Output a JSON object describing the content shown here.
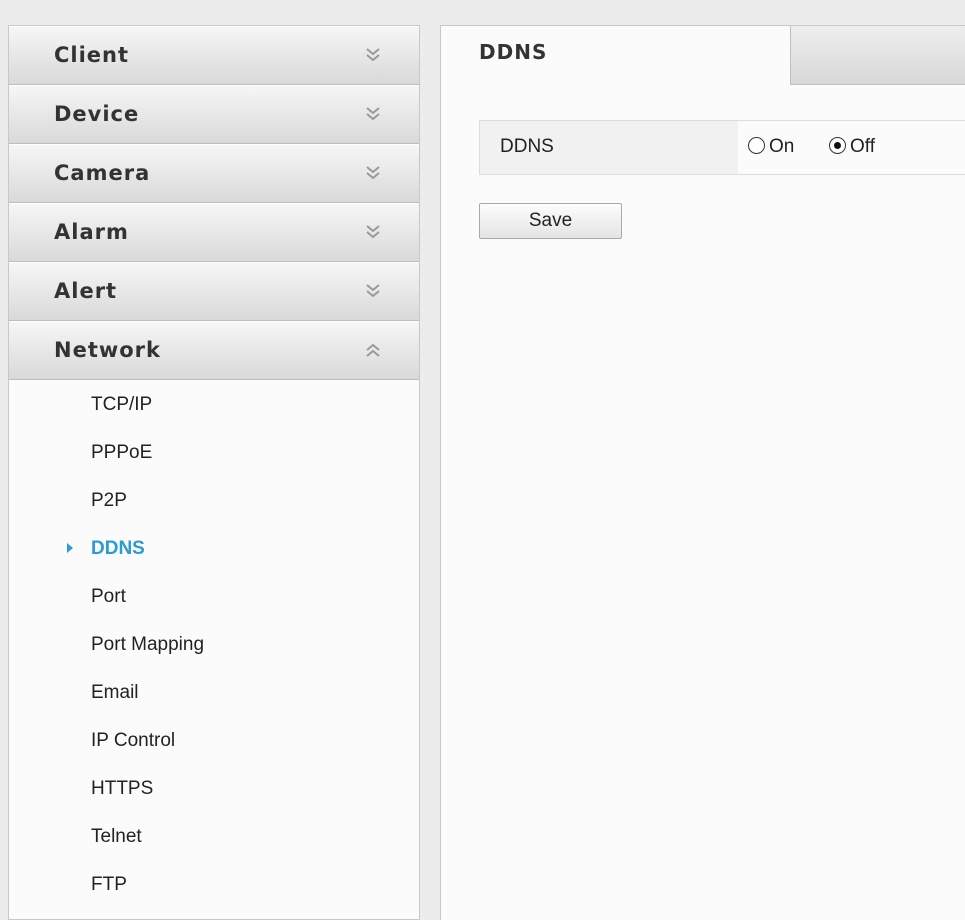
{
  "sidebar": {
    "groups": [
      {
        "label": "Client",
        "state": "collapsed"
      },
      {
        "label": "Device",
        "state": "collapsed"
      },
      {
        "label": "Camera",
        "state": "collapsed"
      },
      {
        "label": "Alarm",
        "state": "collapsed"
      },
      {
        "label": "Alert",
        "state": "collapsed"
      },
      {
        "label": "Network",
        "state": "expanded"
      }
    ],
    "network_items": [
      {
        "label": "TCP/IP"
      },
      {
        "label": "PPPoE"
      },
      {
        "label": "P2P"
      },
      {
        "label": "DDNS",
        "active": true
      },
      {
        "label": "Port"
      },
      {
        "label": "Port Mapping"
      },
      {
        "label": "Email"
      },
      {
        "label": "IP Control"
      },
      {
        "label": "HTTPS"
      },
      {
        "label": "Telnet"
      },
      {
        "label": "FTP"
      }
    ]
  },
  "main": {
    "tab_label": "DDNS",
    "field": {
      "label": "DDNS",
      "options": [
        {
          "label": "On",
          "checked": false
        },
        {
          "label": "Off",
          "checked": true
        }
      ]
    },
    "save_label": "Save"
  },
  "colors": {
    "accent": "#2a9bd3",
    "panel_bg": "#fbfbfb",
    "page_bg": "#ececec"
  },
  "icons": {
    "collapsed": "chevron-double-down-icon",
    "expanded": "chevron-double-up-icon",
    "active_marker": "triangle-right-icon"
  }
}
